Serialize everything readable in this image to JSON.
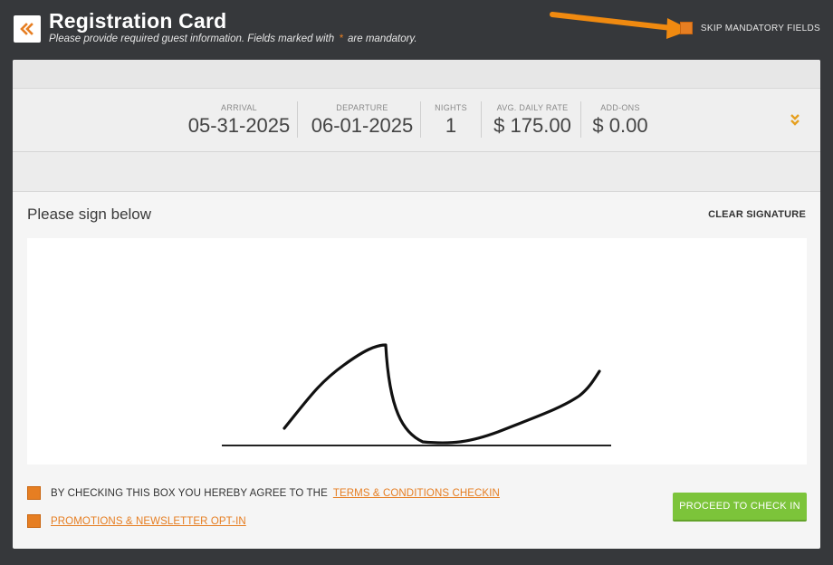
{
  "header": {
    "title": "Registration Card",
    "subtitle_before": "Please provide required guest information. Fields marked with",
    "required_mark": "*",
    "subtitle_after": "are mandatory.",
    "back_icon": "double-chevron-left-icon",
    "skip_label": "SKIP MANDATORY FIELDS"
  },
  "stay": {
    "arrival_label": "ARRIVAL",
    "arrival_value": "05-31-2025",
    "departure_label": "DEPARTURE",
    "departure_value": "06-01-2025",
    "nights_label": "NIGHTS",
    "nights_value": "1",
    "rate_label": "AVG. DAILY RATE",
    "rate_value": "$ 175.00",
    "addons_label": "ADD-ONS",
    "addons_value": "$ 0.00",
    "expand_icon": "double-chevron-down-icon"
  },
  "signature": {
    "title": "Please sign below",
    "clear_label": "CLEAR SIGNATURE"
  },
  "agreements": {
    "terms_prefix": "BY CHECKING THIS BOX YOU HEREBY AGREE TO THE",
    "terms_link": "TERMS & CONDITIONS CHECKIN",
    "promo_link": "PROMOTIONS & NEWSLETTER OPT-IN"
  },
  "actions": {
    "proceed_label": "PROCEED TO CHECK IN"
  },
  "colors": {
    "accent": "#e67e22",
    "success": "#7cc43a",
    "background": "#36383b"
  }
}
